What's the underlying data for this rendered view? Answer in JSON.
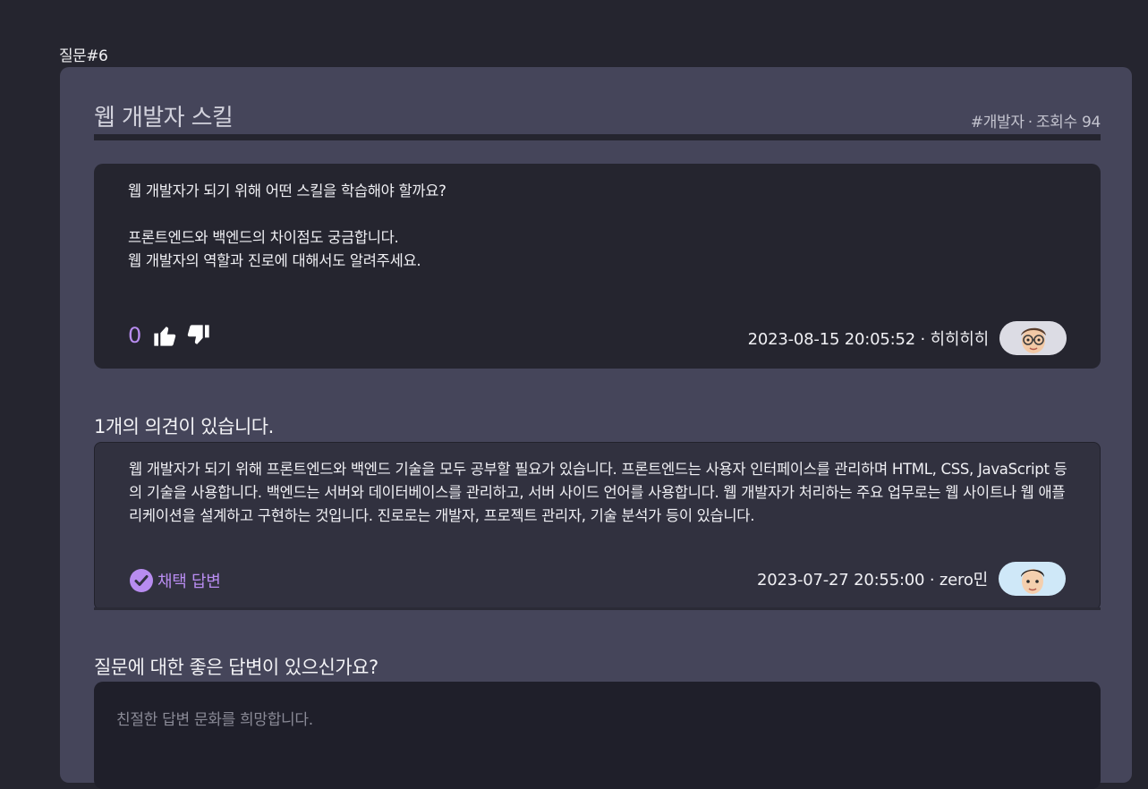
{
  "page_label": "질문#6",
  "question": {
    "title": "웹 개발자 스킬",
    "tag": "#개발자",
    "views_label": "조회수 94",
    "body": "웹 개발자가 되기 위해 어떤 스킬을 학습해야 할까요?\n\n프론트엔드와 백엔드의 차이점도 궁금합니다.\n웹 개발자의 역할과 진로에 대해서도 알려주세요.",
    "vote_count": "0",
    "date": "2023-08-15 20:05:52",
    "author": "히히히히",
    "avatar_icon": "glasses-boy-avatar-icon"
  },
  "comments_heading": "1개의 의견이 있습니다.",
  "answers": [
    {
      "body": "웹 개발자가 되기 위해 프론트엔드와 백엔드 기술을 모두 공부할 필요가 있습니다. 프론트엔드는 사용자 인터페이스를 관리하며 HTML, CSS, JavaScript 등의 기술을 사용합니다. 백엔드는 서버와 데이터베이스를 관리하고, 서버 사이드 언어를 사용합니다. 웹 개발자가 처리하는 주요 업무로는 웹 사이트나 웹 애플리케이션을 설계하고 구현하는 것입니다. 진로로는 개발자, 프로젝트 관리자, 기술 분석가 등이 있습니다.",
      "accepted_label": "채택 답변",
      "date": "2023-07-27 20:55:00",
      "author": "zero민",
      "avatar_icon": "boy-avatar-icon"
    }
  ],
  "reply": {
    "prompt": "질문에 대한 좋은 답변이 있으신가요?",
    "placeholder": "친절한 답변 문화를 희망합니다."
  },
  "colors": {
    "background": "#25252f",
    "card": "#45455a",
    "accent": "#b88cf0"
  }
}
